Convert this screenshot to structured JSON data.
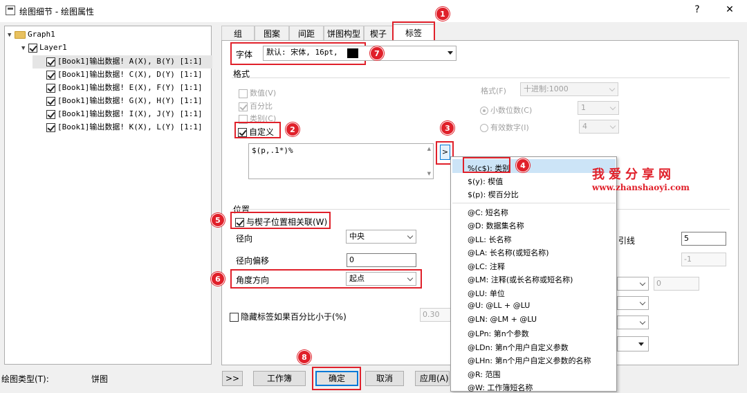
{
  "window": {
    "title": "绘图细节 - 绘图属性",
    "help": "?",
    "close": "✕"
  },
  "tree": {
    "graph": "Graph1",
    "layer": "Layer1",
    "items": [
      "[Book1]输出数据! A(X), B(Y) [1:1]",
      "[Book1]输出数据! C(X), D(Y) [1:1]",
      "[Book1]输出数据! E(X), F(Y) [1:1]",
      "[Book1]输出数据! G(X), H(Y) [1:1]",
      "[Book1]输出数据! I(X), J(Y) [1:1]",
      "[Book1]输出数据! K(X), L(Y) [1:1]"
    ]
  },
  "plot_type": {
    "label": "绘图类型(T):",
    "value": "饼图"
  },
  "tabs": [
    "组",
    "图案",
    "间距",
    "饼图构型",
    "楔子",
    "标签"
  ],
  "font": {
    "label": "字体",
    "value": "默认: 宋体, 16pt,"
  },
  "format": {
    "group": "格式",
    "value": "数值(V)",
    "percent": "百分比",
    "category": "类别(C)",
    "custom": "自定义",
    "custom_text": "$(p,.1*)%",
    "format_label": "格式(F)",
    "format_value": "十进制:1000",
    "decimal_places": "小数位数(C)",
    "decimal_value": "1",
    "sig_digits": "有效数字(I)",
    "sig_value": "4",
    "arrow": ">"
  },
  "position": {
    "group": "位置",
    "link": "与楔子位置相关联(W)",
    "radial": "径向",
    "radial_value": "中央",
    "radial_offset": "径向偏移",
    "radial_offset_value": "0",
    "angle": "角度方向",
    "angle_value": "起点",
    "leader": "引线",
    "leader_value": "5",
    "leader_neg": "-1",
    "extra_zero": "0"
  },
  "hide": {
    "label": "隐藏标签如果百分比小于(%)",
    "value": "0.30"
  },
  "buttons": {
    "expand": ">>",
    "workbook": "工作簿",
    "ok": "确定",
    "cancel": "取消",
    "apply": "应用(A)"
  },
  "menu": {
    "items_top": [
      "%(c$): 类别",
      "$(y): 楔值",
      "$(p): 楔百分比"
    ],
    "items": [
      "@C: 短名称",
      "@D: 数据集名称",
      "@LL: 长名称",
      "@LA: 长名称(或短名称)",
      "@LC: 注释",
      "@LM: 注释(或长名称或短名称)",
      "@LU: 单位",
      "@U: @LL + @LU",
      "@LN: @LM + @LU",
      "@LPn: 第n个参数",
      "@LDn: 第n个用户自定义参数",
      "@LHn: 第n个用户自定义参数的名称",
      "@R: 范围",
      "@W: 工作簿短名称"
    ]
  },
  "badges": [
    "1",
    "2",
    "3",
    "4",
    "5",
    "6",
    "7",
    "8"
  ],
  "watermark": {
    "line1": "我爱分享网",
    "line2": "www.zhanshaoyi.com"
  },
  "colors": {
    "annotation": "#e0202a",
    "font_swatch": "#000000"
  }
}
